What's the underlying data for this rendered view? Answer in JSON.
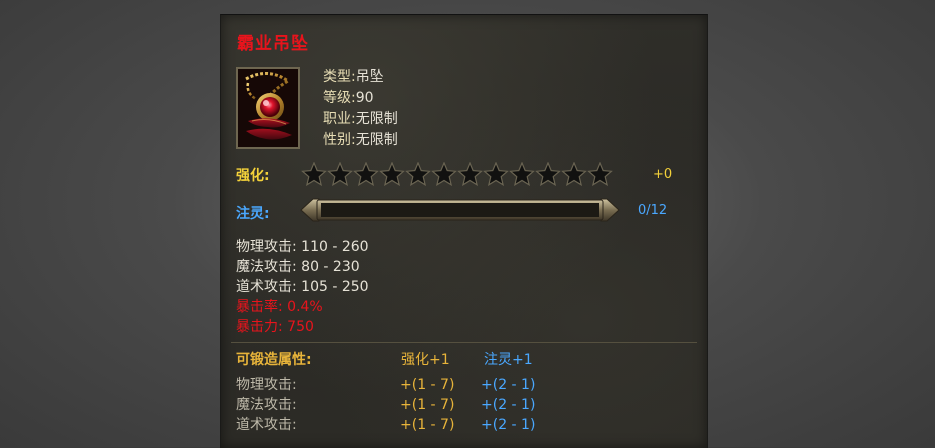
{
  "item": {
    "name": "霸业吊坠",
    "icon": "pendant-icon",
    "info": [
      {
        "key": "类型:",
        "value": "吊坠"
      },
      {
        "key": "等级:",
        "value": "90"
      },
      {
        "key": "职业:",
        "value": "无限制"
      },
      {
        "key": "性别:",
        "value": "无限制"
      }
    ]
  },
  "strengthen": {
    "label": "强化:",
    "value": "+0",
    "stars_total": 12,
    "stars_filled": 0
  },
  "spirit": {
    "label": "注灵:",
    "value": "0/12",
    "fill_fraction": 0
  },
  "stats": [
    {
      "text": "物理攻击: 110 - 260",
      "red": false
    },
    {
      "text": "魔法攻击: 80 - 230",
      "red": false
    },
    {
      "text": "道术攻击: 105 - 250",
      "red": false
    },
    {
      "text": "暴击率: 0.4%",
      "red": true
    },
    {
      "text": "暴击力: 750",
      "red": true
    }
  ],
  "forge": {
    "title": "可锻造属性:",
    "col_strengthen": "强化+1",
    "col_spirit": "注灵+1",
    "rows": [
      {
        "name": "物理攻击:",
        "strengthen": "+(1 - 7)",
        "spirit": "+(2 - 1)"
      },
      {
        "name": "魔法攻击:",
        "strengthen": "+(1 - 7)",
        "spirit": "+(2 - 1)"
      },
      {
        "name": "道术攻击:",
        "strengthen": "+(1 - 7)",
        "spirit": "+(2 - 1)"
      }
    ]
  },
  "colors": {
    "name_red": "#e8141c",
    "gold": "#f4d23a",
    "blue": "#4aa8ff"
  }
}
